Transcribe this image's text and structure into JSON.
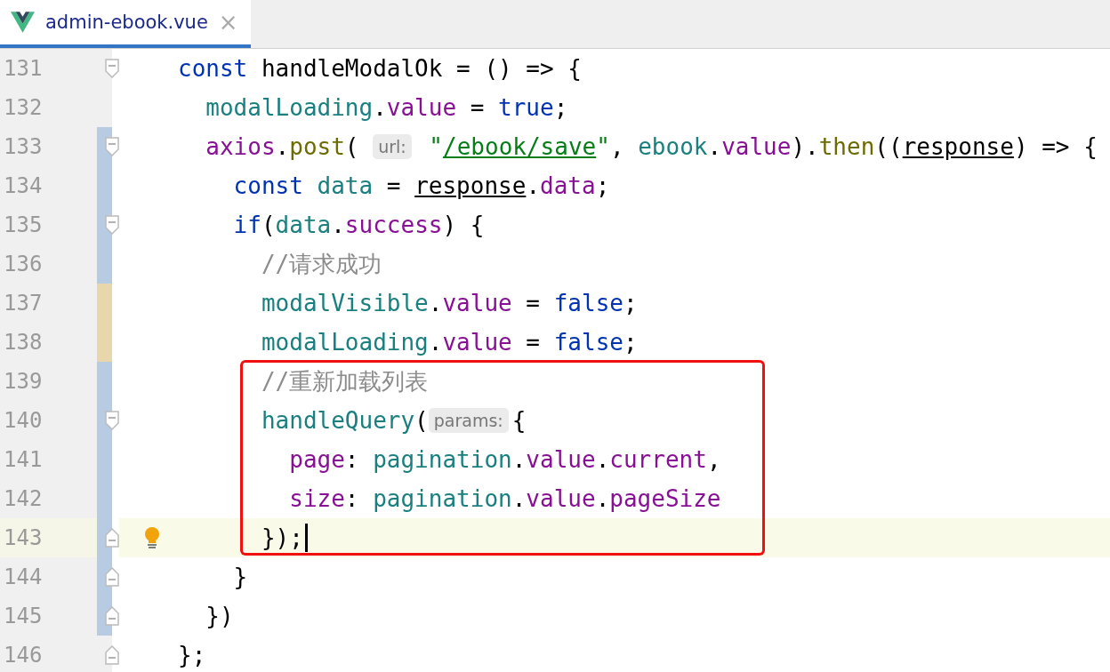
{
  "tabs": [
    {
      "label": "admin-ebook.vue",
      "close": "×",
      "selected": true
    }
  ],
  "lines": [
    {
      "number": "131",
      "fold_open": true,
      "fold_close": false,
      "current": false,
      "bulb": false,
      "boxed": false,
      "tokens": [
        {
          "kind": "kw",
          "text": "const "
        },
        {
          "kind": "plain",
          "text": "handleModalOk = () => {"
        }
      ]
    },
    {
      "number": "132",
      "fold_open": false,
      "fold_close": false,
      "current": false,
      "bulb": false,
      "boxed": false,
      "tokens": [
        {
          "kind": "var",
          "text": "  modalLoading"
        },
        {
          "kind": "plain",
          "text": "."
        },
        {
          "kind": "prop",
          "text": "value"
        },
        {
          "kind": "plain",
          "text": " = "
        },
        {
          "kind": "kw",
          "text": "true"
        },
        {
          "kind": "plain",
          "text": ";"
        }
      ]
    },
    {
      "number": "133",
      "color": "#b7cce2",
      "fold_open": true,
      "fold_close": false,
      "current": false,
      "bulb": false,
      "boxed": false,
      "tokens": [
        {
          "kind": "prop",
          "text": "  axios"
        },
        {
          "kind": "plain",
          "text": "."
        },
        {
          "kind": "func",
          "text": "post"
        },
        {
          "kind": "plain",
          "text": "( "
        },
        {
          "kind": "hint",
          "text": "url:"
        },
        {
          "kind": "string",
          "text": " \""
        },
        {
          "kind": "link",
          "text": "/ebook/save"
        },
        {
          "kind": "string",
          "text": "\""
        },
        {
          "kind": "plain",
          "text": ", "
        },
        {
          "kind": "var",
          "text": "ebook"
        },
        {
          "kind": "plain",
          "text": "."
        },
        {
          "kind": "prop",
          "text": "value"
        },
        {
          "kind": "plain",
          "text": ")."
        },
        {
          "kind": "func",
          "text": "then"
        },
        {
          "kind": "plain",
          "text": "(("
        },
        {
          "kind": "ref",
          "text": "response"
        },
        {
          "kind": "plain",
          "text": ") => {"
        }
      ]
    },
    {
      "number": "134",
      "color": "#b7cce2",
      "fold_open": false,
      "fold_close": false,
      "current": false,
      "bulb": false,
      "boxed": false,
      "tokens": [
        {
          "kind": "kw",
          "text": "    const "
        },
        {
          "kind": "var",
          "text": "data"
        },
        {
          "kind": "plain",
          "text": " = "
        },
        {
          "kind": "ref",
          "text": "response"
        },
        {
          "kind": "plain",
          "text": "."
        },
        {
          "kind": "prop",
          "text": "data"
        },
        {
          "kind": "plain",
          "text": ";"
        }
      ]
    },
    {
      "number": "135",
      "color": "#b7cce2",
      "fold_open": true,
      "fold_close": false,
      "current": false,
      "bulb": false,
      "boxed": false,
      "tokens": [
        {
          "kind": "kw",
          "text": "    if"
        },
        {
          "kind": "plain",
          "text": "("
        },
        {
          "kind": "var",
          "text": "data"
        },
        {
          "kind": "plain",
          "text": "."
        },
        {
          "kind": "prop",
          "text": "success"
        },
        {
          "kind": "plain",
          "text": ") {"
        }
      ]
    },
    {
      "number": "136",
      "color": "#b7cce2",
      "fold_open": false,
      "fold_close": false,
      "current": false,
      "bulb": false,
      "boxed": false,
      "tokens": [
        {
          "kind": "comment",
          "text": "      //请求成功"
        }
      ]
    },
    {
      "number": "137",
      "color": "#e8d6ad",
      "fold_open": false,
      "fold_close": false,
      "current": false,
      "bulb": false,
      "boxed": false,
      "tokens": [
        {
          "kind": "var",
          "text": "      modalVisible"
        },
        {
          "kind": "plain",
          "text": "."
        },
        {
          "kind": "prop",
          "text": "value"
        },
        {
          "kind": "plain",
          "text": " = "
        },
        {
          "kind": "kw",
          "text": "false"
        },
        {
          "kind": "plain",
          "text": ";"
        }
      ]
    },
    {
      "number": "138",
      "color": "#e8d6ad",
      "fold_open": false,
      "fold_close": false,
      "current": false,
      "bulb": false,
      "boxed": false,
      "tokens": [
        {
          "kind": "var",
          "text": "      modalLoading"
        },
        {
          "kind": "plain",
          "text": "."
        },
        {
          "kind": "prop",
          "text": "value"
        },
        {
          "kind": "plain",
          "text": " = "
        },
        {
          "kind": "kw",
          "text": "false"
        },
        {
          "kind": "plain",
          "text": ";"
        }
      ]
    },
    {
      "number": "139",
      "color": "#b7cce2",
      "fold_open": false,
      "fold_close": false,
      "current": false,
      "bulb": false,
      "boxed": true,
      "tokens": [
        {
          "kind": "comment",
          "text": "      //重新加载列表"
        }
      ]
    },
    {
      "number": "140",
      "color": "#b7cce2",
      "fold_open": true,
      "fold_close": false,
      "current": false,
      "bulb": false,
      "boxed": true,
      "tokens": [
        {
          "kind": "var",
          "text": "      handleQuery"
        },
        {
          "kind": "plain",
          "text": "("
        },
        {
          "kind": "hint",
          "text": "params:"
        },
        {
          "kind": "plain",
          "text": "{"
        }
      ]
    },
    {
      "number": "141",
      "color": "#b7cce2",
      "fold_open": false,
      "fold_close": false,
      "current": false,
      "bulb": false,
      "boxed": true,
      "tokens": [
        {
          "kind": "prop",
          "text": "        page"
        },
        {
          "kind": "plain",
          "text": ": "
        },
        {
          "kind": "var",
          "text": "pagination"
        },
        {
          "kind": "plain",
          "text": "."
        },
        {
          "kind": "prop",
          "text": "value"
        },
        {
          "kind": "plain",
          "text": "."
        },
        {
          "kind": "prop",
          "text": "current"
        },
        {
          "kind": "plain",
          "text": ","
        }
      ]
    },
    {
      "number": "142",
      "color": "#b7cce2",
      "fold_open": false,
      "fold_close": false,
      "current": false,
      "bulb": false,
      "boxed": true,
      "tokens": [
        {
          "kind": "prop",
          "text": "        size"
        },
        {
          "kind": "plain",
          "text": ": "
        },
        {
          "kind": "var",
          "text": "pagination"
        },
        {
          "kind": "plain",
          "text": "."
        },
        {
          "kind": "prop",
          "text": "value"
        },
        {
          "kind": "plain",
          "text": "."
        },
        {
          "kind": "prop",
          "text": "pageSize"
        }
      ]
    },
    {
      "number": "143",
      "color": "#b7cce2",
      "fold_open": false,
      "fold_close": true,
      "current": true,
      "bulb": true,
      "boxed": true,
      "tokens": [
        {
          "kind": "plain",
          "text": "      });"
        }
      ]
    },
    {
      "number": "144",
      "color": "#b7cce2",
      "fold_open": false,
      "fold_close": true,
      "current": false,
      "bulb": false,
      "boxed": false,
      "tokens": [
        {
          "kind": "plain",
          "text": "    }"
        }
      ]
    },
    {
      "number": "145",
      "color": "#b7cce2",
      "fold_open": false,
      "fold_close": true,
      "current": false,
      "bulb": false,
      "boxed": false,
      "tokens": [
        {
          "kind": "plain",
          "text": "  })"
        }
      ]
    },
    {
      "number": "146",
      "fold_open": false,
      "fold_close": true,
      "current": false,
      "bulb": false,
      "boxed": false,
      "tokens": [
        {
          "kind": "plain",
          "text": "};"
        }
      ]
    }
  ]
}
